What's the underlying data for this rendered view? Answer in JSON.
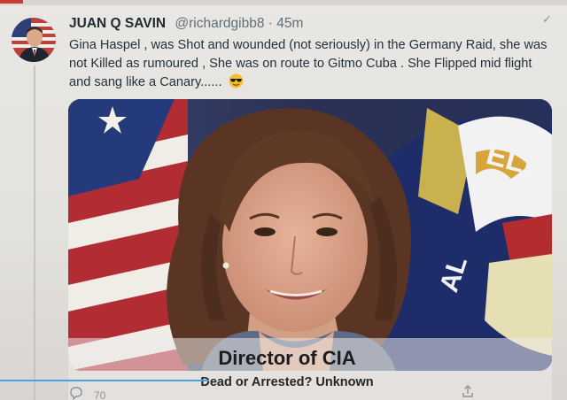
{
  "tweet": {
    "author_name": "JUAN Q SAVIN",
    "handle_and_time": "@richardgibb8 · 45m",
    "text": "Gina Haspel , was Shot and wounded (not seriously) in the Germany Raid, she was not Killed as rumoured , She was on route to Gitmo Cuba . She Flipped mid flight and sang like a Canary......",
    "emoji": "sunglasses-emoji",
    "reply_count": "70"
  },
  "media": {
    "caption_title": "Director of CIA",
    "caption_subtitle": "Dead or Arrested? Unknown"
  },
  "icons": {
    "menu": "chevron-down-icon",
    "reply": "reply-icon",
    "share": "share-icon"
  },
  "colors": {
    "accent": "#4aa3e0",
    "name": "#1d2a33",
    "muted": "#5f6f79"
  }
}
